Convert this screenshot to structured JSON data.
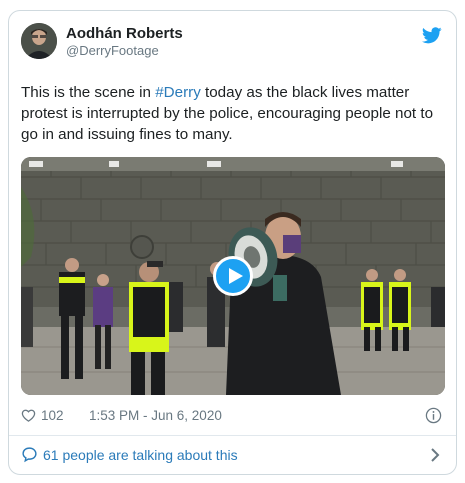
{
  "tweet": {
    "author_name": "Aodhán Roberts",
    "author_handle": "@DerryFootage",
    "text_before": "This is the scene in ",
    "hashtag": "#Derry",
    "text_after": " today as the black lives matter protest is interrupted by the police, encouraging people not to go in and issuing fines to many.",
    "likes": "102",
    "timestamp": "1:53 PM - Jun 6, 2020",
    "talking_label": "61 people are talking about this"
  },
  "icons": {
    "brand": "twitter-bird-icon",
    "like": "heart-icon",
    "info": "info-icon",
    "reply": "speech-bubble-icon",
    "navigate": "chevron-right-icon",
    "video": "play-icon"
  },
  "colors": {
    "link": "#2b7bb9",
    "brand": "#1da1f2",
    "muted": "#697882",
    "text": "#1c2022",
    "border": "#cfd9de"
  }
}
